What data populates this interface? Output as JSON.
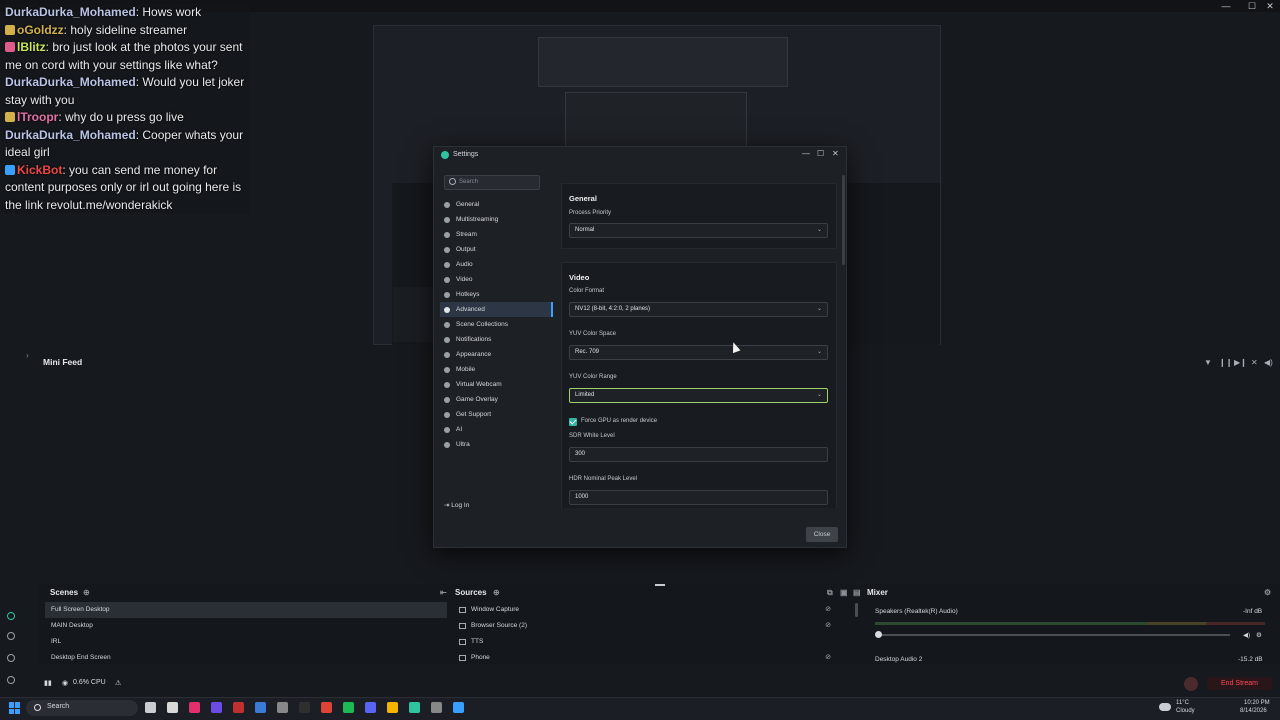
{
  "window": {
    "minimize": "—",
    "maximize": "☐",
    "close": "✕"
  },
  "chat": [
    {
      "user": "DurkaDurka_Mohamed",
      "text": ": Hows work",
      "color": "u-blue"
    },
    {
      "user": "oGoldzz",
      "text": ": holy sideline streamer",
      "color": "u-orange"
    },
    {
      "user": "lBlitz",
      "text": ": bro just look at the photos your sent me on cord with your settings like what?",
      "color": "u-green"
    },
    {
      "user": "DurkaDurka_Mohamed",
      "text": ": Would you let joker stay with you",
      "color": "u-blue"
    },
    {
      "user": "lTroopr",
      "text": ": why do u press go live",
      "color": "u-pink"
    },
    {
      "user": "DurkaDurka_Mohamed",
      "text": ": Cooper whats your ideal girl",
      "color": "u-blue"
    },
    {
      "user": "KickBot",
      "text": ": you can send me money for content purposes only or irl out going here is the link revolut.me/wonderakick",
      "color": "u-red"
    }
  ],
  "minifeed": {
    "title": "Mini Feed"
  },
  "settings": {
    "title": "Settings",
    "search_placeholder": "Search",
    "nav": [
      "General",
      "Multistreaming",
      "Stream",
      "Output",
      "Audio",
      "Video",
      "Hotkeys",
      "Advanced",
      "Scene Collections",
      "Notifications",
      "Appearance",
      "Mobile",
      "Virtual Webcam",
      "Game Overlay",
      "Get Support",
      "AI",
      "Ultra"
    ],
    "active_nav": "Advanced",
    "login": "Log In",
    "general": {
      "title": "General",
      "process_priority_label": "Process Priority",
      "process_priority_value": "Normal"
    },
    "video": {
      "title": "Video",
      "color_format_label": "Color Format",
      "color_format_value": "NV12 (8-bit, 4:2:0, 2 planes)",
      "yuv_space_label": "YUV Color Space",
      "yuv_space_value": "Rec. 709",
      "yuv_range_label": "YUV Color Range",
      "yuv_range_value": "Limited",
      "force_gpu_label": "Force GPU as render device",
      "sdr_label": "SDR White Level",
      "sdr_value": "300",
      "hdr_label": "HDR Nominal Peak Level",
      "hdr_value": "1000"
    },
    "close": "Close"
  },
  "scenes": {
    "title": "Scenes",
    "items": [
      "Full Screen Desktop",
      "MAIN Desktop",
      "IRL",
      "Desktop End Screen"
    ]
  },
  "sources": {
    "title": "Sources",
    "items": [
      "Window Capture",
      "Browser Source (2)",
      "TTS",
      "Phone"
    ]
  },
  "mixer": {
    "title": "Mixer",
    "channels": [
      {
        "name": "Speakers (Realtek(R) Audio)",
        "db": "-Inf dB"
      },
      {
        "name": "Desktop Audio 2",
        "db": "-15.2 dB"
      }
    ]
  },
  "status": {
    "cpu": "0.6% CPU",
    "end_stream": "End Stream"
  },
  "taskbar": {
    "search": "Search",
    "weather_temp": "11°C",
    "weather_desc": "Cloudy",
    "time": "10:20 PM",
    "date": "8/14/2026"
  }
}
